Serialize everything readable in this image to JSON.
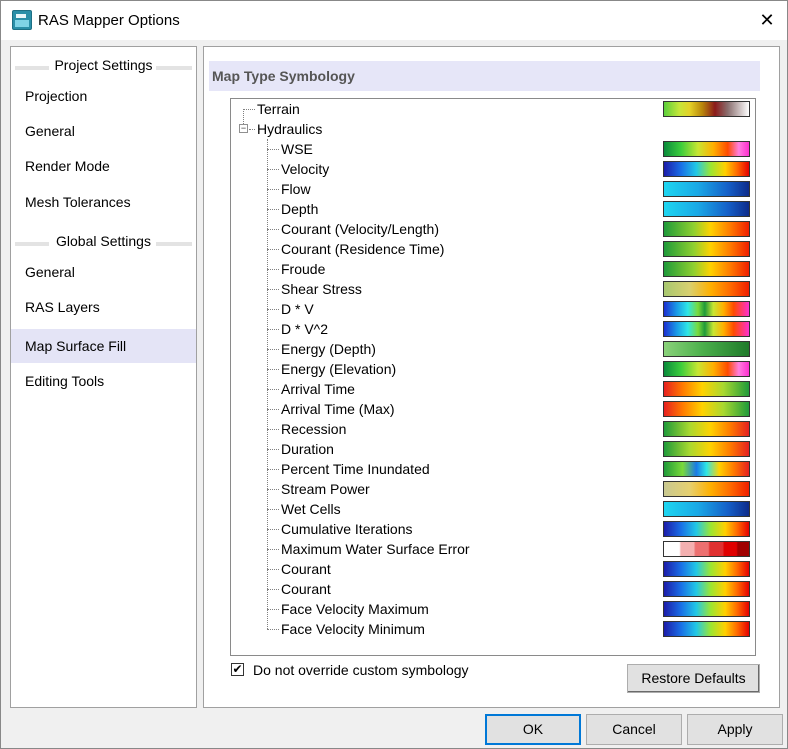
{
  "window": {
    "title": "RAS Mapper Options",
    "close_glyph": "✕"
  },
  "sidebar": {
    "project_header": "Project Settings",
    "project_items": [
      "Projection",
      "General",
      "Render Mode",
      "Mesh Tolerances"
    ],
    "global_header": "Global Settings",
    "global_items": [
      "General",
      "RAS Layers",
      "Map Surface Fill",
      "Editing Tools"
    ],
    "active_item": "Map Surface Fill"
  },
  "main": {
    "title": "Map Type Symbology",
    "tree": {
      "terrain": {
        "label": "Terrain",
        "swatch": "linear-gradient(90deg,#5bcf3c 0%,#c6e63a 18%,#e4d228 30%,#b8860b 45%,#8b1a1a 60%,#8a6f6f 75%,#ffffff 100%)"
      },
      "hydraulics": {
        "label": "Hydraulics",
        "expander": "−"
      },
      "items": [
        {
          "label": "WSE",
          "swatch": "linear-gradient(90deg,#0a8a3c 0%,#3ccd3c 20%,#c8e632 40%,#ffb000 58%,#ff4b00 75%,#ff7fe0 88%,#ff2fd0 100%)"
        },
        {
          "label": "Velocity",
          "swatch": "linear-gradient(90deg,#1c1ca8 0%,#1a6fe6 20%,#22c8e6 38%,#9be632 55%,#ffd000 72%,#ff6a00 86%,#e60000 100%)"
        },
        {
          "label": "Flow",
          "swatch": "linear-gradient(90deg,#1ed6f0 0%,#1aa8e6 40%,#1560c8 75%,#0e2b8a 100%)"
        },
        {
          "label": "Depth",
          "swatch": "linear-gradient(90deg,#1ed6f0 0%,#1aa8e6 40%,#1560c8 75%,#0e2b8a 100%)"
        },
        {
          "label": "Courant (Velocity/Length)",
          "swatch": "linear-gradient(90deg,#1f9a3a 0%,#8fd030 35%,#ffd200 55%,#ff7a00 78%,#f01e00 100%)"
        },
        {
          "label": "Courant (Residence Time)",
          "swatch": "linear-gradient(90deg,#1f9a3a 0%,#8fd030 35%,#ffd200 55%,#ff7a00 78%,#f01e00 100%)"
        },
        {
          "label": "Froude",
          "swatch": "linear-gradient(90deg,#1f9a3a 0%,#8fd030 35%,#ffd200 55%,#ff7a00 78%,#f01e00 100%)"
        },
        {
          "label": "Shear Stress",
          "swatch": "linear-gradient(90deg,#a8c870 0%,#d8d070 30%,#ffb000 55%,#ff6a00 78%,#f01e00 100%)"
        },
        {
          "label": "D * V",
          "swatch": "linear-gradient(90deg,#1c2fd0 0%,#1a9ae6 15%,#2ee6e6 28%,#7ad93a 40%,#1f9a3a 48%,#c8e632 58%,#ffb000 70%,#ff4b00 82%,#ff2fd0 100%)"
        },
        {
          "label": "D * V^2",
          "swatch": "linear-gradient(90deg,#1c2fd0 0%,#1a9ae6 15%,#2ee6e6 28%,#7ad93a 40%,#1f9a3a 48%,#c8e632 58%,#ffb000 70%,#ff4b00 82%,#ff2fd0 100%)"
        },
        {
          "label": "Energy (Depth)",
          "swatch": "linear-gradient(90deg,#8ad27a 0%,#4cb04c 45%,#1f7a2a 100%)"
        },
        {
          "label": "Energy (Elevation)",
          "swatch": "linear-gradient(90deg,#0a8a3c 0%,#3ccd3c 20%,#c8e632 40%,#ffb000 58%,#ff4b00 75%,#ff7fe0 88%,#ff2fd0 100%)"
        },
        {
          "label": "Arrival Time",
          "swatch": "linear-gradient(90deg,#e62020 0%,#ff7a00 22%,#ffd200 45%,#a8d830 70%,#1f9a3a 100%)"
        },
        {
          "label": "Arrival Time (Max)",
          "swatch": "linear-gradient(90deg,#e62020 0%,#ff7a00 22%,#ffd200 45%,#a8d830 70%,#1f9a3a 100%)"
        },
        {
          "label": "Recession",
          "swatch": "linear-gradient(90deg,#1f9a3a 0%,#a8d830 30%,#ffd200 55%,#ff7a00 78%,#e62020 100%)"
        },
        {
          "label": "Duration",
          "swatch": "linear-gradient(90deg,#1f9a3a 0%,#a8d830 30%,#ffd200 55%,#ff7a00 78%,#e62020 100%)"
        },
        {
          "label": "Percent Time Inundated",
          "swatch": "linear-gradient(90deg,#1f9a3a 0%,#7ad93a 22%,#1a7ae6 38%,#2ee6e6 50%,#ffd200 65%,#ff7a00 82%,#e62020 100%)"
        },
        {
          "label": "Stream Power",
          "swatch": "linear-gradient(90deg,#c8c890 0%,#e6d070 30%,#ffb000 55%,#ff6a00 78%,#f01e00 100%)"
        },
        {
          "label": "Wet Cells",
          "swatch": "linear-gradient(90deg,#1ed6f0 0%,#1aa8e6 40%,#1560c8 75%,#0e2b8a 100%)"
        },
        {
          "label": "Cumulative Iterations",
          "swatch": "linear-gradient(90deg,#1c1ca8 0%,#1a6fe6 20%,#22c8e6 38%,#9be632 55%,#ffd000 72%,#ff6a00 86%,#e60000 100%)"
        },
        {
          "label": "Maximum Water Surface Error",
          "swatch": "linear-gradient(90deg,#ffffff 0%,#ffffff 18%,#f4b0b0 20%,#f4b0b0 35%,#ec7070 37%,#ec7070 52%,#e03030 54%,#e03030 69%,#e00000 71%,#e00000 85%,#a00000 87%,#a00000 100%)"
        },
        {
          "label": "Courant",
          "swatch": "linear-gradient(90deg,#1c1ca8 0%,#1a6fe6 20%,#22c8e6 38%,#9be632 55%,#ffd000 72%,#ff6a00 86%,#e60000 100%)"
        },
        {
          "label": "Courant",
          "swatch": "linear-gradient(90deg,#1c1ca8 0%,#1a6fe6 20%,#22c8e6 38%,#9be632 55%,#ffd000 72%,#ff6a00 86%,#e60000 100%)"
        },
        {
          "label": "Face Velocity Maximum",
          "swatch": "linear-gradient(90deg,#1c1ca8 0%,#1a6fe6 20%,#22c8e6 38%,#9be632 55%,#ffd000 72%,#ff6a00 86%,#e60000 100%)"
        },
        {
          "label": "Face Velocity Minimum",
          "swatch": "linear-gradient(90deg,#1c1ca8 0%,#1a6fe6 20%,#22c8e6 38%,#9be632 55%,#ffd000 72%,#ff6a00 86%,#e60000 100%)"
        }
      ]
    },
    "override_checkbox": {
      "label": "Do not override custom symbology",
      "checked": true,
      "glyph": "✔"
    },
    "restore_label": "Restore Defaults"
  },
  "footer": {
    "ok_label": "OK",
    "cancel_label": "Cancel",
    "apply_label": "Apply"
  }
}
